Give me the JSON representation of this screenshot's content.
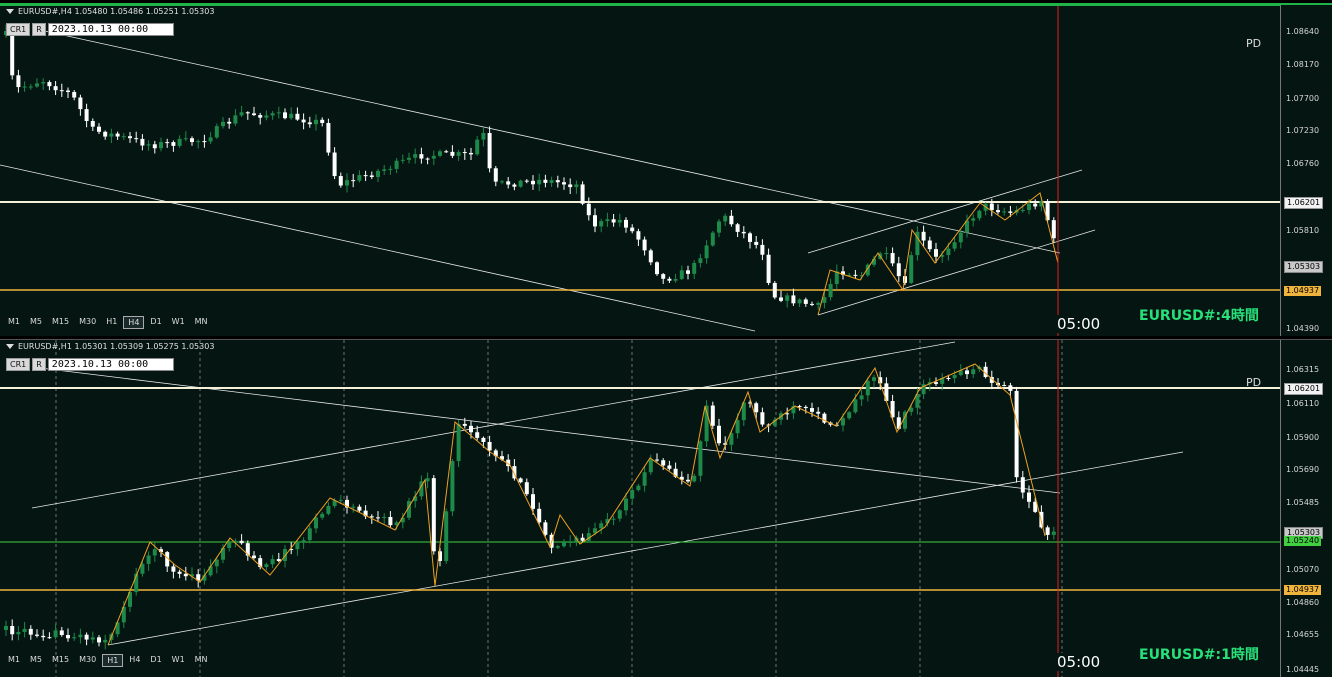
{
  "top": {
    "header": "EURUSD#,H4  1.05480 1.05486 1.05251 1.05303",
    "btn_cr": "CR1",
    "btn_r": "R",
    "date": "2023.10.13 00:00",
    "pd": "PD",
    "time_label": "05:00",
    "title": "EURUSD#:4時間",
    "timeframes": [
      "M1",
      "M5",
      "M15",
      "M30",
      "H1",
      "H4",
      "D1",
      "W1",
      "MN"
    ],
    "active_timeframe": "H4",
    "ticks": [
      "1.08640",
      "1.08170",
      "1.07700",
      "1.07230",
      "1.06760",
      "1.05810",
      "1.04390"
    ],
    "tag_resistance": "1.06201",
    "tag_price": "1.05303",
    "tag_support": "1.04937"
  },
  "bottom": {
    "header": "EURUSD#,H1  1.05301 1.05309 1.05275 1.05303",
    "btn_cr": "CR1",
    "btn_r": "R",
    "date": "2023.10.13 00:00",
    "pd": "PD",
    "time_label": "05:00",
    "title": "EURUSD#:1時間",
    "timeframes": [
      "M1",
      "M5",
      "M15",
      "M30",
      "H1",
      "H4",
      "D1",
      "W1",
      "MN"
    ],
    "active_timeframe": "H1",
    "ticks": [
      "1.06315",
      "1.06110",
      "1.05900",
      "1.05690",
      "1.05485",
      "1.05070",
      "1.04860",
      "1.04655",
      "1.04445"
    ],
    "tag_price": "1.05303",
    "tag_resistance": "1.06201",
    "tag_green": "1.05240",
    "tag_support": "1.04937"
  },
  "colors": {
    "background": "#041512",
    "bull_candle": "#1e8a4a",
    "bear_candle": "#ffffff",
    "zigzag": "#f0a020",
    "support_line": "#f0b43c",
    "resistance_line": "#f5f0d8",
    "green_line": "#3fcf3f",
    "now_line": "#e02020",
    "title": "#28e07a"
  }
}
